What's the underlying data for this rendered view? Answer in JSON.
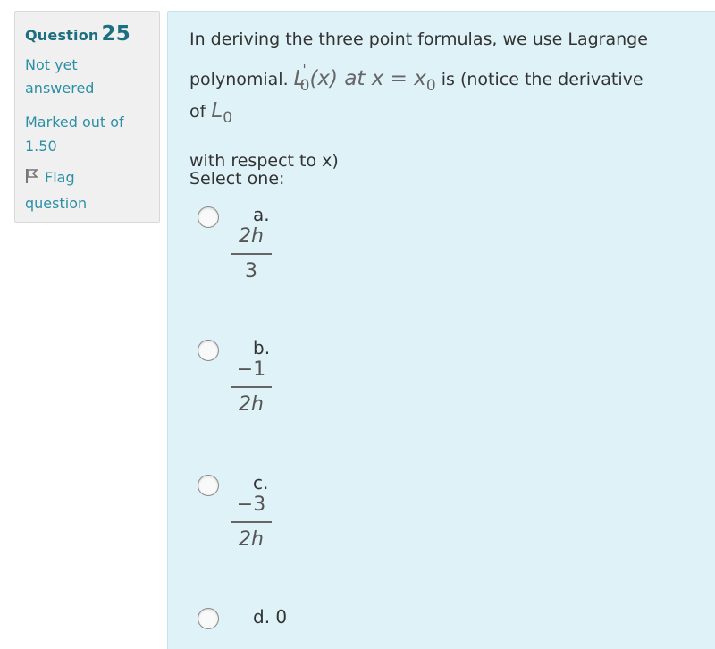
{
  "info": {
    "question_label": "Question",
    "question_number": "25",
    "state": "Not yet answered",
    "grade": "Marked out of 1.50",
    "flag_label": "Flag question"
  },
  "question": {
    "line1": "In deriving the three point formulas, we use Lagrange",
    "line2_prefix": "polynomial.",
    "math_L": "L",
    "math_prime": "'",
    "math_sub0": "0",
    "math_of_x": "(x) at x = x",
    "math_x_sub": "0",
    "line2_suffix": "is (notice the derivative",
    "line3_prefix": "of",
    "line3_L": "L",
    "line3_sub": "0",
    "line4": "with respect to x)"
  },
  "prompt": "Select one:",
  "options": [
    {
      "letter": "a.",
      "numerator": "2h",
      "denominator": "3"
    },
    {
      "letter": "b.",
      "numerator": "−1",
      "denominator": "2h"
    },
    {
      "letter": "c.",
      "numerator": "−3",
      "denominator": "2h"
    },
    {
      "letter": "d. 0"
    }
  ],
  "colors": {
    "info_link": "#2d8fa6",
    "question_number": "#1b6f7f",
    "content_background": "#def2f8",
    "info_background": "#f0f0f0"
  },
  "icons": {
    "flag": "flag-icon"
  }
}
